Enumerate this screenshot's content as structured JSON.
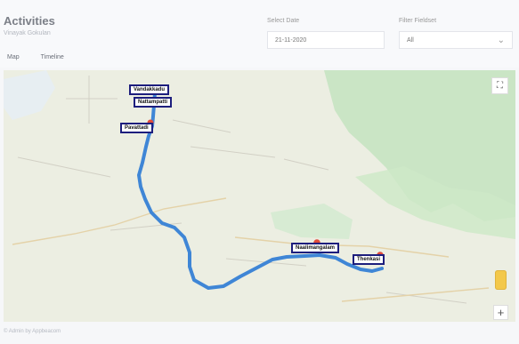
{
  "app": {
    "title": "Activities",
    "subtitle": "Vinayak Gokulan"
  },
  "filters": {
    "date_label": "Select Date",
    "date_value": "21-11-2020",
    "filter_label": "Filter Fieldset",
    "filter_value": "All"
  },
  "tabs": [
    {
      "label": "Map"
    },
    {
      "label": "Timeline"
    }
  ],
  "map": {
    "labels": [
      "Vandakkadu",
      "Nattampatti",
      "Pavattadi",
      "Naalimangalam",
      "Thenkasi"
    ],
    "controls": {
      "fullscreen_icon": "fullscreen-icon",
      "pegman_icon": "pegman-icon",
      "zoom_plus": "+"
    },
    "colors": {
      "route": "#3f86d6",
      "marker": "#e14b3b",
      "label_border": "#1d1e7d"
    }
  },
  "footer": {
    "text": "© Admin by Appbeacom"
  }
}
